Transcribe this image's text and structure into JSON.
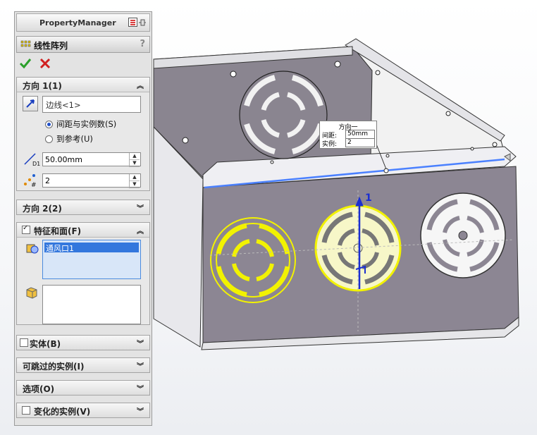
{
  "panel": {
    "title": "PropertyManager",
    "feature_title": "线性阵列",
    "help": "?",
    "direction1": {
      "title": "方向 1(1)",
      "edge_value": "边线<1>",
      "radio_spacing": "间距与实例数(S)",
      "radio_reference": "到参考(U)",
      "spacing_value": "50.00mm",
      "count_value": "2",
      "spacing_sub": "D1",
      "count_sub": "#"
    },
    "direction2": {
      "title": "方向 2(2)"
    },
    "features": {
      "title": "特征和面(F)",
      "item": "通风口1"
    },
    "bodies": {
      "title": "实体(B)"
    },
    "skip": {
      "title": "可跳过的实例(I)"
    },
    "options": {
      "title": "选项(O)"
    },
    "varied": {
      "title": "变化的实例(V)"
    }
  },
  "callout": {
    "title": "方向一",
    "spacing_label": "间距:",
    "spacing_value": "50mm",
    "count_label": "实例:",
    "count_value": "2"
  },
  "viewport": {
    "arrow_label": "1"
  },
  "colors": {
    "selection": "#f2f200",
    "accent": "#1a2fd1",
    "edge": "#4a80ff"
  }
}
